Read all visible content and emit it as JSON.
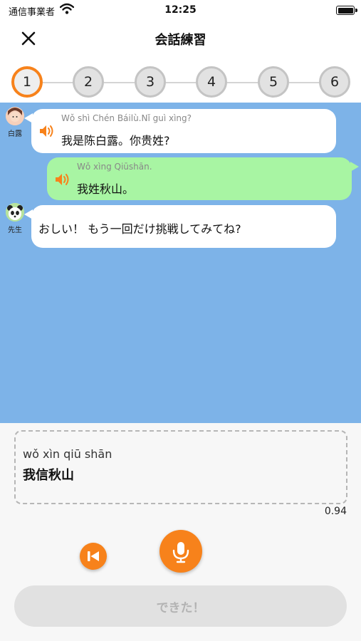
{
  "status_bar": {
    "carrier": "通信事業者",
    "time": "12:25"
  },
  "header": {
    "title": "会話練習",
    "close_icon": "close-icon"
  },
  "steps": [
    {
      "label": "1",
      "active": true
    },
    {
      "label": "2",
      "active": false
    },
    {
      "label": "3",
      "active": false
    },
    {
      "label": "4",
      "active": false
    },
    {
      "label": "5",
      "active": false
    },
    {
      "label": "6",
      "active": false
    }
  ],
  "chat": {
    "background": "#7db3e8",
    "messages": [
      {
        "speaker": "白露",
        "pinyin": "Wǒ shì Chén Báilù.Nǐ guì xìng?",
        "text": "我是陈白露。你贵姓?"
      },
      {
        "speaker": "",
        "pinyin": "Wǒ xìng Qiūshān.",
        "text": "我姓秋山。"
      },
      {
        "speaker": "先生",
        "pinyin": "",
        "text": "おしい！ もう一回だけ挑戦してみてね?"
      }
    ]
  },
  "result": {
    "pinyin": "wǒ xìn qiū shān",
    "text": "我信秋山",
    "score": "0.94"
  },
  "controls": {
    "replay_icon": "skip-back-icon",
    "mic_icon": "microphone-icon",
    "accent": "#f7821b"
  },
  "done_button": {
    "label": "できた！"
  }
}
